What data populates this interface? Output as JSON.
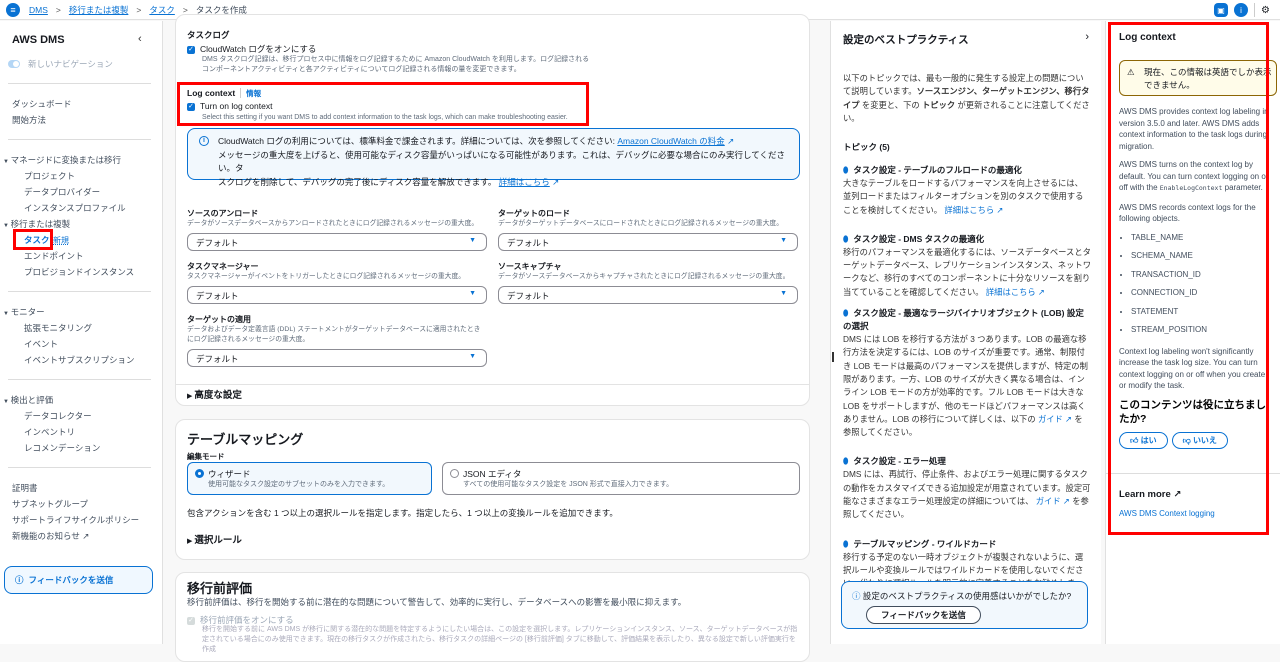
{
  "breadcrumb": [
    "DMS",
    "移行または複製",
    "タスク"
  ],
  "breadcrumb_current": "タスクを作成",
  "sidebar": {
    "title": "AWS DMS",
    "toggle_label": "新しいナビゲーション",
    "items_top": [
      "ダッシュボード",
      "開始方法"
    ],
    "group1": "マネージドに変換または移行",
    "group1_items": [
      "プロジェクト",
      "データプロバイダー",
      "インスタンスプロファイル"
    ],
    "group2": "移行または複製",
    "group2_items": [
      "タスク",
      "エンドポイント",
      "プロビジョンドインスタンス"
    ],
    "new_badge": "新規",
    "group3": "モニター",
    "group3_items": [
      "拡張モニタリング",
      "イベント",
      "イベントサブスクリプション"
    ],
    "group4": "検出と評価",
    "group4_items": [
      "データコレクター",
      "インベントリ",
      "レコメンデーション"
    ],
    "items_bottom": [
      "証明書",
      "サブネットグループ",
      "サポートライフサイクルポリシー",
      "新機能のお知らせ"
    ],
    "feedback_label": "フィードバックを送信"
  },
  "task_log": {
    "heading": "タスクログ",
    "cloudwatch_label": "CloudWatch ログをオンにする",
    "cloudwatch_desc1": "DMS タスクログ記録は、移行プロセス中に情報をログ記録するために Amazon CloudWatch を利用します。ログ記録される",
    "cloudwatch_desc2": "コンポーネントアクティビティと各アクティビティについてログ記録される情報の量を変更できます。",
    "log_context_heading": "Log context",
    "info_link": "情報",
    "log_context_label": "Turn on log context",
    "log_context_desc": "Select this setting if you want DMS to add context information to the task logs, which can make troubleshooting easier.",
    "info_text1": "CloudWatch ログの利用については、標準料金で課金されます。詳細については、次を参照してください: ",
    "info_link1": "Amazon CloudWatch の料金",
    "info_text2": "メッセージの重大度を上げると、使用可能なディスク容量がいっぱいになる可能性があります。これは、デバッグに必要な場合にのみ実行してください。タ",
    "info_text3": "スクログを削除して、デバッグの完了後にディスク容量を解放できます。",
    "info_link2": "詳細はこちら",
    "selects": [
      {
        "label": "ソースのアンロード",
        "desc": "データがソースデータベースからアンロードされたときにログ記録されるメッセージの重大度。",
        "value": "デフォルト"
      },
      {
        "label": "ターゲットのロード",
        "desc": "データがターゲットデータベースにロードされたときにログ記録されるメッセージの重大度。",
        "value": "デフォルト"
      },
      {
        "label": "タスクマネージャー",
        "desc": "タスクマネージャーがイベントをトリガーしたときにログ記録されるメッセージの重大度。",
        "value": "デフォルト"
      },
      {
        "label": "ソースキャプチャ",
        "desc": "データがソースデータベースからキャプチャされたときにログ記録されるメッセージの重大度。",
        "value": "デフォルト"
      },
      {
        "label": "ターゲットの適用",
        "desc": "データおよびデータ定義言語 (DDL) ステートメントがターゲットデータベースに適用されたときにログ記録されるメッセージの重大度。",
        "value": "デフォルト"
      }
    ],
    "advanced": "高度な設定"
  },
  "table_mapping": {
    "heading": "テーブルマッピング",
    "mode_label": "編集モード",
    "wizard_label": "ウィザード",
    "wizard_desc": "使用可能なタスク設定のサブセットのみを入力できます。",
    "json_label": "JSON エディタ",
    "json_desc": "すべての使用可能なタスク設定を JSON 形式で直接入力できます。",
    "note": "包含アクションを含む 1 つ以上の選択ルールを指定します。指定したら、1 つ以上の変換ルールを追加できます。",
    "rules": "選択ルール"
  },
  "premigration": {
    "heading": "移行前評価",
    "desc": "移行前評価は、移行を開始する前に潜在的な問題について警告して、効率的に実行し、データベースへの影響を最小限に抑えます。",
    "checkbox_label": "移行前評価をオンにする",
    "checkbox_desc": "移行を開始する前に AWS DMS が移行に関する潜在的な問題を特定するようにしたい場合は、この設定を選択します。レプリケーションインスタンス、ソース、ターゲットデータベースが指定されている場合にのみ使用できます。現在の移行タスクが作成されたら、移行タスクの詳細ページの [移行前評価] タブに移動して、評価結果を表示したり、異なる設定で新しい評価実行を作成"
  },
  "best_practices": {
    "title": "設定のベストプラクティス",
    "intro_a": "以下のトピックでは、最も一般的に発生する設定上の問題について説明しています。",
    "intro_b": "ソースエンジン、ターゲットエンジン、移行タイプ",
    "intro_c": " を変更と、下の ",
    "intro_d": "トピック",
    "intro_e": " が更新されることに注意してください。",
    "topics_heading": "トピック (5)",
    "topics": [
      {
        "title": "タスク設定 - テーブルのフルロードの最適化",
        "body": "大きなテーブルをロードするパフォーマンスを向上させるには、並列ロードまたはフィルターオプションを別のタスクで使用することを検討してください。",
        "link": "詳細はこちら",
        "after": ""
      },
      {
        "title": "タスク設定 - DMS タスクの最適化",
        "body": "移行のパフォーマンスを最適化するには、ソースデータベースとターゲットデータベース、レプリケーションインスタンス、ネットワークなど、移行のすべてのコンポーネントに十分なリソースを割り当てていることを確認してください。",
        "link": "詳細はこちら",
        "after": ""
      },
      {
        "title": "タスク設定 - 最適なラージバイナリオブジェクト (LOB) 設定の選択",
        "body": "DMS には LOB を移行する方法が 3 つあります。LOB の最適な移行方法を決定するには、LOB のサイズが重要です。通常、制限付き LOB モードは最高のパフォーマンスを提供しますが、特定の制限があります。一方、LOB のサイズが大きく異なる場合は、インライン LOB モードの方が効率的です。フル LOB モードは大きな LOB をサポートしますが、他のモードほどパフォーマンスは高くありません。LOB の移行について詳しくは、以下の ",
        "link": "ガイド",
        "after": " を参照してください。"
      },
      {
        "title": "タスク設定 - エラー処理",
        "body": "DMS には、再試行、停止条件、およびエラー処理に関するタスクの動作をカスタマイズできる追加設定が用意されています。設定可能なさまざまなエラー処理設定の詳細については、",
        "link": "ガイド",
        "after": " を参照してください。"
      },
      {
        "title": "テーブルマッピング - ワイルドカード",
        "body": "移行する予定のない一時オブジェクトが複製されないように、選択ルールや変換ルールではワイルドカードを使用しないでください。代わりに選択ルールを明示的に定義することをお勧めします。",
        "link": "詳細はこちら",
        "after": ""
      }
    ],
    "feedback_question": "設定のベストプラクティスの使用感はいかがでしたか?",
    "feedback_button": "フィードバックを送信"
  },
  "help_panel": {
    "title": "Log context",
    "warning": "現在、この情報は英語でしか表示できません。",
    "p1": "AWS DMS provides context log labeling in version 3.5.0 and later. AWS DMS adds context information to the task logs during migration.",
    "p2a": "AWS DMS turns on the context log by default. You can turn context logging on or off with the ",
    "p2_code": "EnableLogContext",
    "p2b": " parameter.",
    "p3": "AWS DMS records context logs for the following objects.",
    "objects": [
      "TABLE_NAME",
      "SCHEMA_NAME",
      "TRANSACTION_ID",
      "CONNECTION_ID",
      "STATEMENT",
      "STREAM_POSITION"
    ],
    "p4": "Context log labeling won't significantly increase the task log size. You can turn context logging on or off when you create or modify the task.",
    "helpful_q": "このコンテンツは役に立ちましたか?",
    "yes": "はい",
    "no": "いいえ",
    "learn_more": "Learn more",
    "learn_link": "AWS DMS Context logging"
  }
}
